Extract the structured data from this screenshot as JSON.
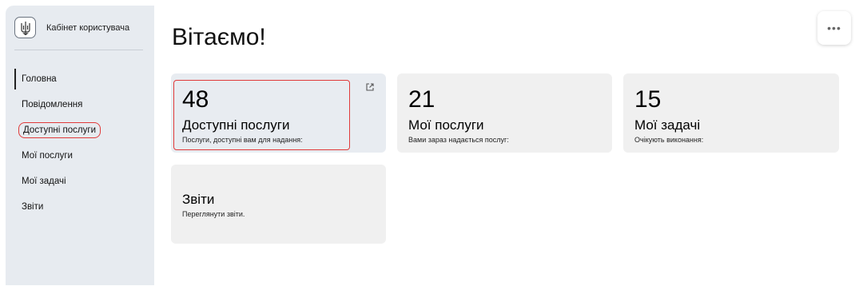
{
  "sidebar": {
    "brand_title": "Кабінет користувача",
    "items": [
      {
        "label": "Головна"
      },
      {
        "label": "Повідомлення"
      },
      {
        "label": "Доступні послуги"
      },
      {
        "label": "Мої послуги"
      },
      {
        "label": "Мої задачі"
      },
      {
        "label": "Звіти"
      }
    ]
  },
  "header": {
    "title": "Вітаємо!",
    "more_label": "•••"
  },
  "cards": [
    {
      "count": "48",
      "title": "Доступні послуги",
      "subtitle": "Послуги, доступні вам для надання:"
    },
    {
      "count": "21",
      "title": "Мої послуги",
      "subtitle": "Вами зараз надається послуг:"
    },
    {
      "count": "15",
      "title": "Мої задачі",
      "subtitle": "Очікують виконання:"
    },
    {
      "count": "",
      "title": "Звіти",
      "subtitle": "Переглянути звіти."
    }
  ],
  "colors": {
    "highlight": "#e03a3a",
    "sidebar_bg": "#e7ebf0",
    "card_bg": "#f0f0f0"
  },
  "icons": [
    "trident-icon",
    "external-link-icon",
    "more-icon"
  ]
}
